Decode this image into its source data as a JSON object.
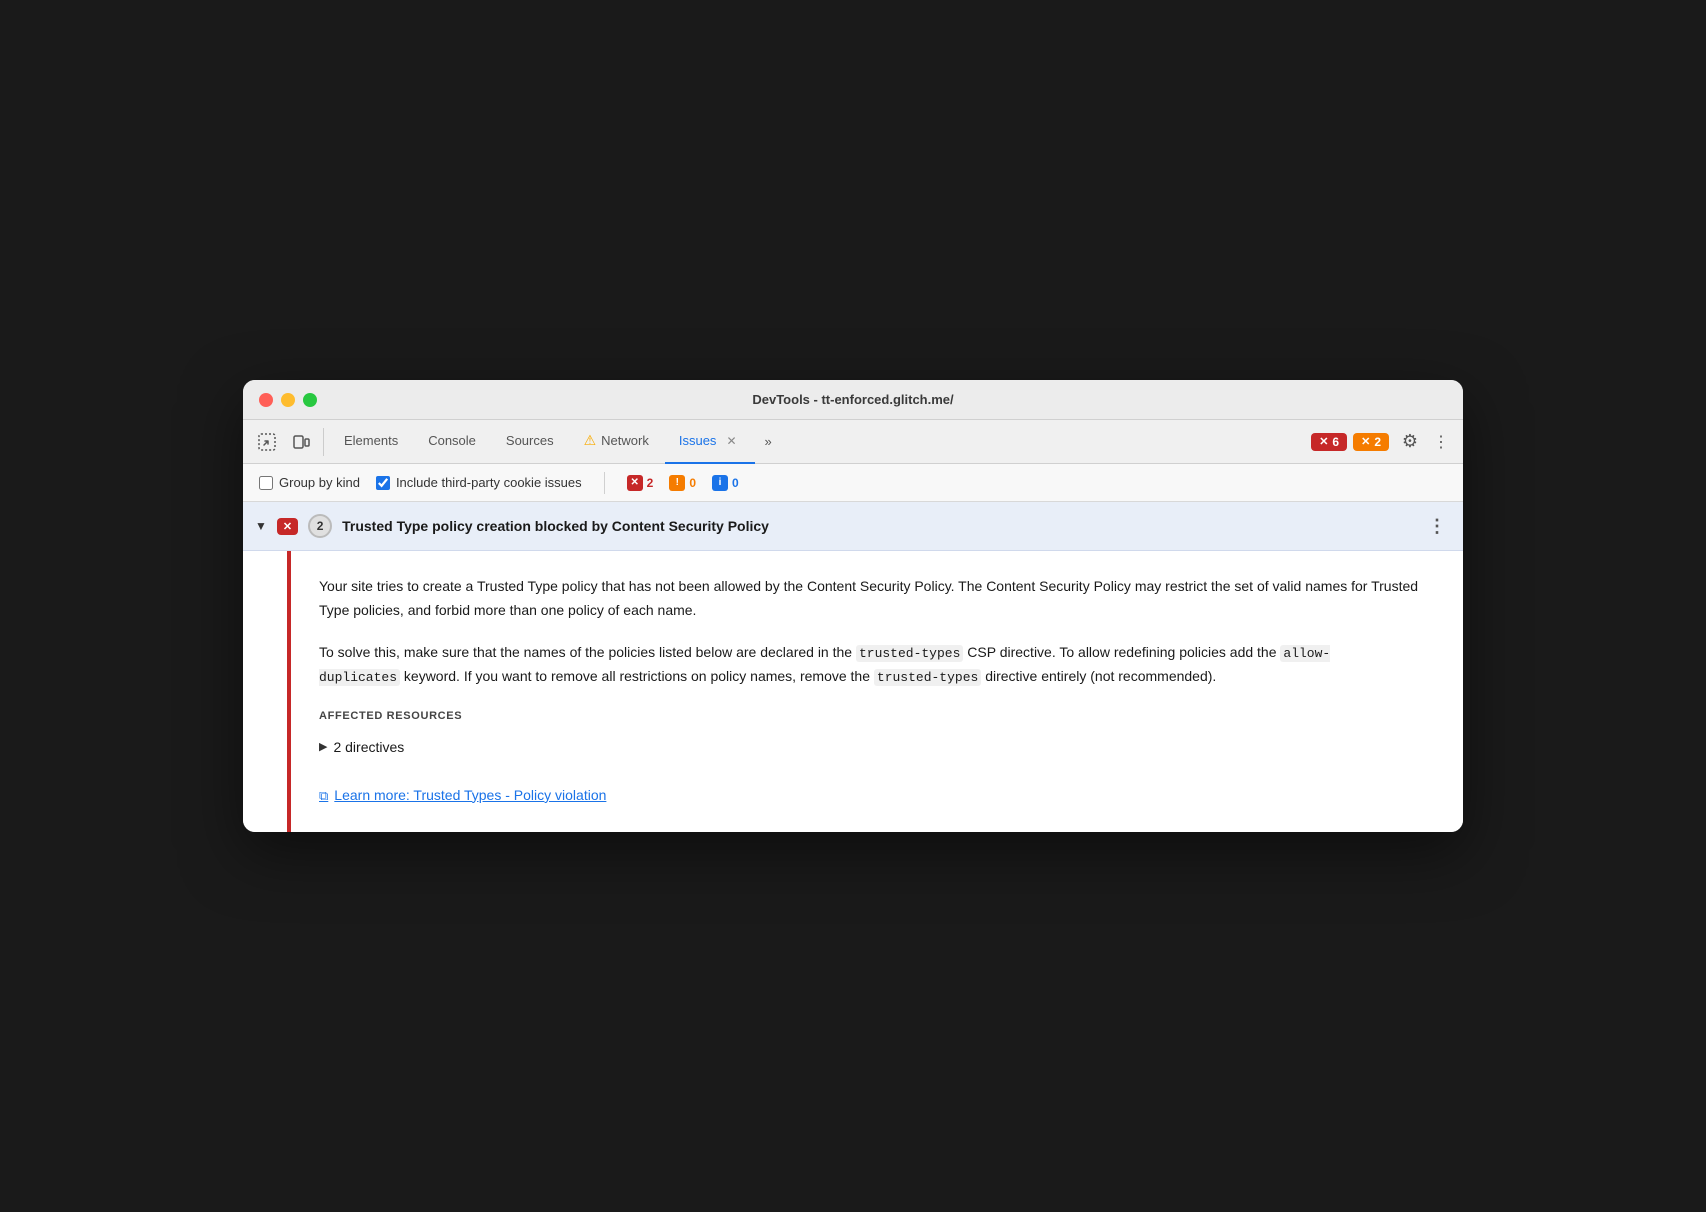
{
  "window": {
    "title": "DevTools - tt-enforced.glitch.me/"
  },
  "tabs": {
    "elements": "Elements",
    "console": "Console",
    "sources": "Sources",
    "network": "Network",
    "issues": "Issues",
    "more": "»"
  },
  "badges": {
    "error_count": "6",
    "warning_count": "2"
  },
  "sub_toolbar": {
    "group_by_kind": "Group by kind",
    "include_third_party": "Include third-party cookie issues",
    "error_count": "2",
    "warning_count": "0",
    "info_count": "0"
  },
  "issue": {
    "count": "2",
    "title": "Trusted Type policy creation blocked by Content Security Policy",
    "description1": "Your site tries to create a Trusted Type policy that has not been allowed by the Content Security Policy. The Content Security Policy may restrict the set of valid names for Trusted Type policies, and forbid more than one policy of each name.",
    "description2_pre": "To solve this, make sure that the names of the policies listed below are declared in the",
    "code1": "trusted-types",
    "description2_mid1": "CSP directive. To allow redefining policies add the",
    "code2": "allow-duplicates",
    "description2_mid2": "keyword. If you want to remove all restrictions on policy names, remove the",
    "code3": "trusted-types",
    "description2_post": "directive entirely (not recommended).",
    "affected_resources_label": "AFFECTED RESOURCES",
    "directives_label": "2 directives",
    "learn_more_label": "Learn more: Trusted Types - Policy violation"
  }
}
